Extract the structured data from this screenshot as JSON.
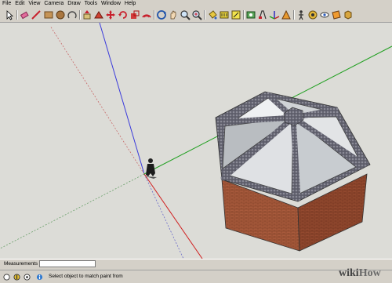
{
  "menu": [
    "File",
    "Edit",
    "View",
    "Camera",
    "Draw",
    "Tools",
    "Window",
    "Help"
  ],
  "toolbar_icons": [
    "select-arrow-icon",
    "eraser-icon",
    "pencil-line-icon",
    "rectangle-icon",
    "circle-icon",
    "arc-icon",
    "push-pull-icon",
    "follow-me-icon",
    "move-icon",
    "rotate-icon",
    "scale-icon",
    "offset-icon",
    "orbit-icon",
    "pan-icon",
    "zoom-icon",
    "zoom-extents-icon",
    "paint-bucket-icon",
    "tape-measure-icon",
    "dimension-icon",
    "protractor-icon",
    "text-icon",
    "axes-icon",
    "3d-text-icon",
    "walk-icon",
    "position-camera-icon",
    "look-around-icon",
    "section-plane-icon",
    "components-icon"
  ],
  "measurements": {
    "label": "Measurements",
    "value": ""
  },
  "status": {
    "text": "Select object to match paint from"
  },
  "colors": {
    "viewport_bg": "#dcdcd7",
    "blue_axis": "#3a3adb",
    "green_axis": "#22a022",
    "red_axis": "#d02020",
    "brick": "#a0583a",
    "glass": "#e6e8ea",
    "roof_frame": "#5c5c66"
  },
  "watermark": {
    "part1": "wiki",
    "part2": "How"
  }
}
